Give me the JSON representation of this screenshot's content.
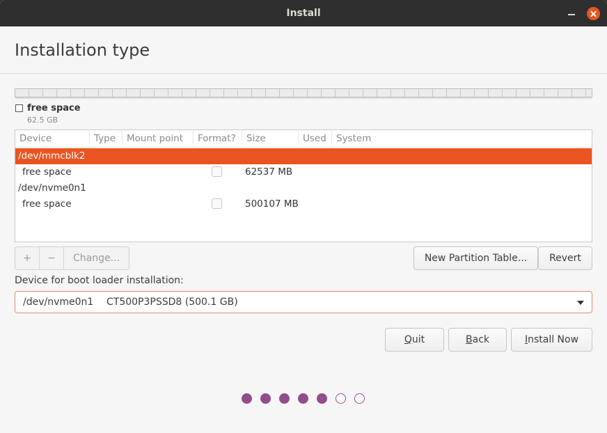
{
  "window": {
    "title": "Install"
  },
  "page": {
    "title": "Installation type"
  },
  "legend": {
    "label": "free space",
    "size": "62.5 GB"
  },
  "table": {
    "columns": [
      "Device",
      "Type",
      "Mount point",
      "Format?",
      "Size",
      "Used",
      "System"
    ],
    "rows": [
      {
        "device": "/dev/mmcblk2",
        "size": "",
        "selected": true
      },
      {
        "device": "free space",
        "size": "62537 MB",
        "format_checked": false
      },
      {
        "device": "/dev/nvme0n1",
        "size": ""
      },
      {
        "device": "free space",
        "size": "500107 MB",
        "format_checked": false
      }
    ]
  },
  "partition_buttons": {
    "add": "+",
    "remove": "−",
    "change": "Change..."
  },
  "table_buttons": {
    "new_partition_table": "New Partition Table...",
    "revert": "Revert"
  },
  "boot_loader": {
    "label": "Device for boot loader installation:",
    "selected_device": "/dev/nvme0n1",
    "selected_model": "CT500P3PSSD8 (500.1 GB)"
  },
  "actions": {
    "quit_mnemonic": "Q",
    "quit_rest": "uit",
    "back_mnemonic": "B",
    "back_rest": "ack",
    "install_mnemonic": "I",
    "install_rest": "nstall Now"
  },
  "progress": {
    "total_steps": 7,
    "completed_steps": 5,
    "color": "#924d8b"
  },
  "colors": {
    "accent": "#e95420",
    "titlebar": "#2f2f2f"
  },
  "icons": {
    "close": "close-icon",
    "minimize": "minimize-icon",
    "dropdown": "chevron-down-icon"
  }
}
